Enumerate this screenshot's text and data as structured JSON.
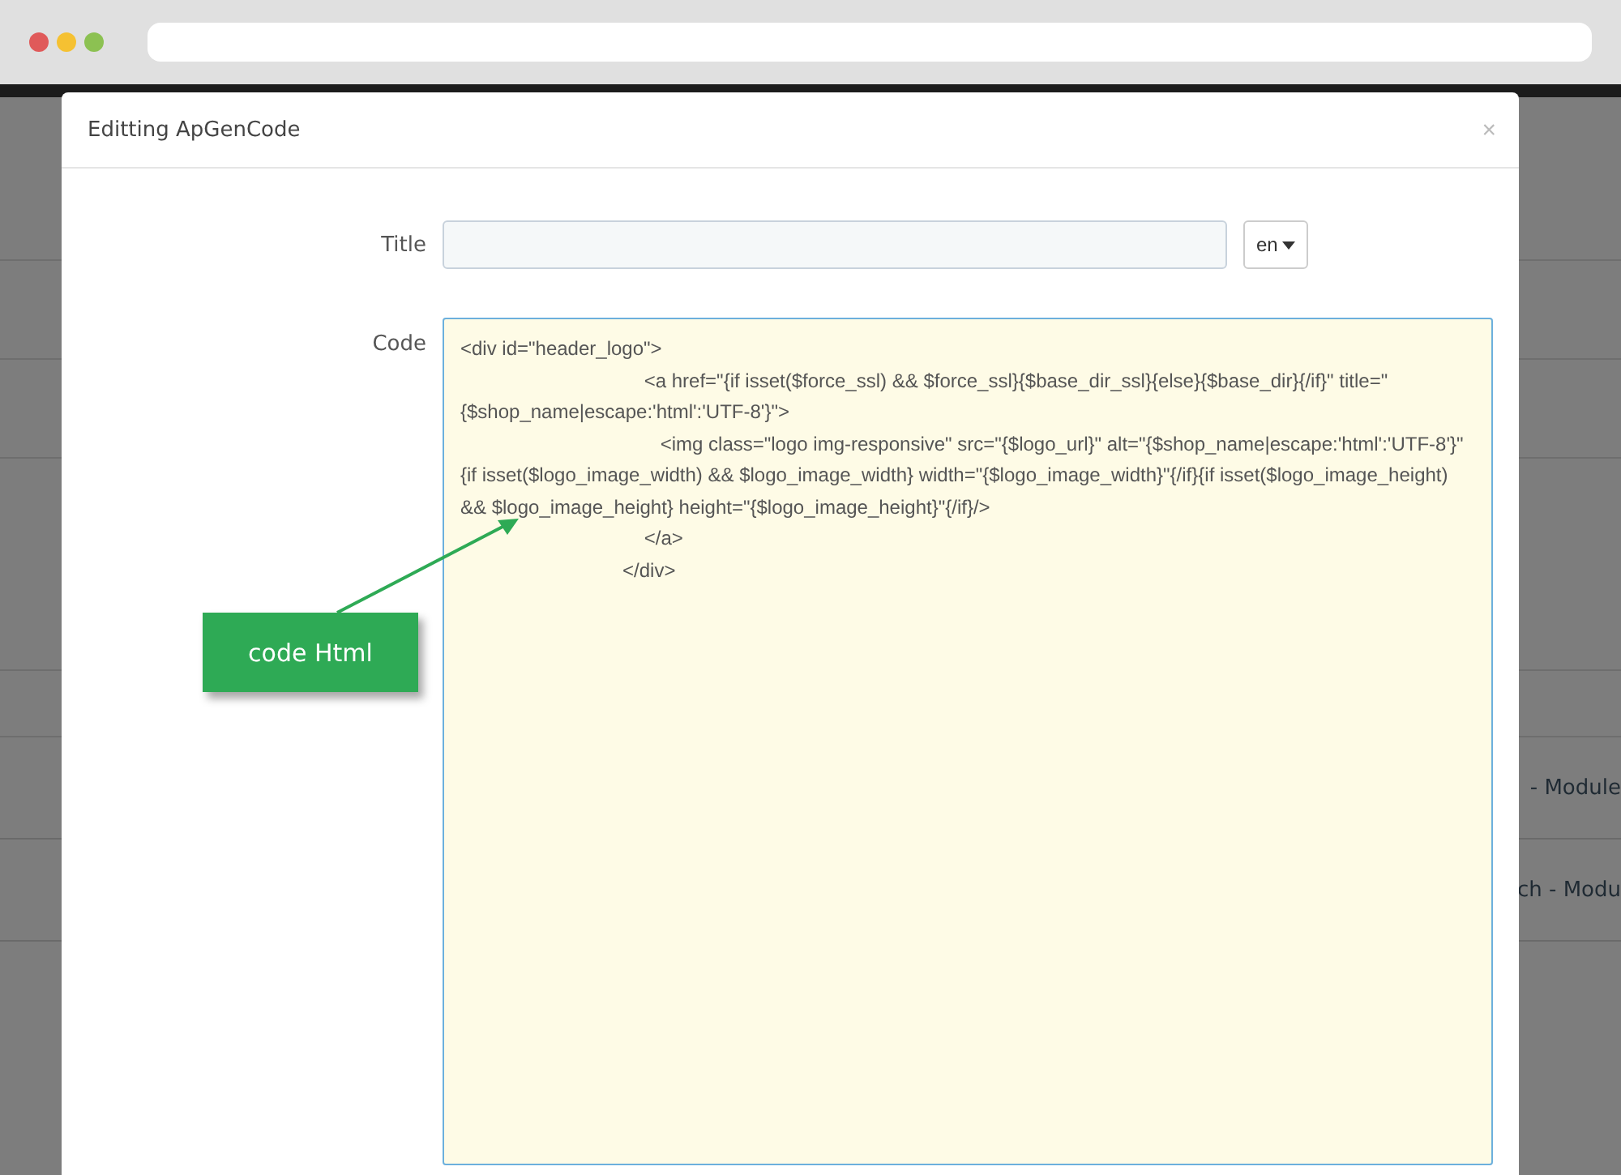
{
  "modal": {
    "title": "Editting ApGenCode",
    "close": "×",
    "title_field": {
      "label": "Title"
    },
    "language": {
      "value": "en"
    },
    "code_field": {
      "label": "Code",
      "value": "<div id=\"header_logo\">\n                                  <a href=\"{if isset($force_ssl) && $force_ssl}{$base_dir_ssl}{else}{$base_dir}{/if}\" title=\"{$shop_name|escape:'html':'UTF-8'}\">\n                                     <img class=\"logo img-responsive\" src=\"{$logo_url}\" alt=\"{$shop_name|escape:'html':'UTF-8'}\"{if isset($logo_image_width) && $logo_image_width} width=\"{$logo_image_width}\"{/if}{if isset($logo_image_height) && $logo_image_height} height=\"{$logo_image_height}\"{/if}/>\n                                  </a>\n                              </div>"
    }
  },
  "callout": {
    "label": "code Html"
  },
  "background_rows": [
    {
      "text": "- Module"
    },
    {
      "text": "ch - Modu"
    }
  ]
}
